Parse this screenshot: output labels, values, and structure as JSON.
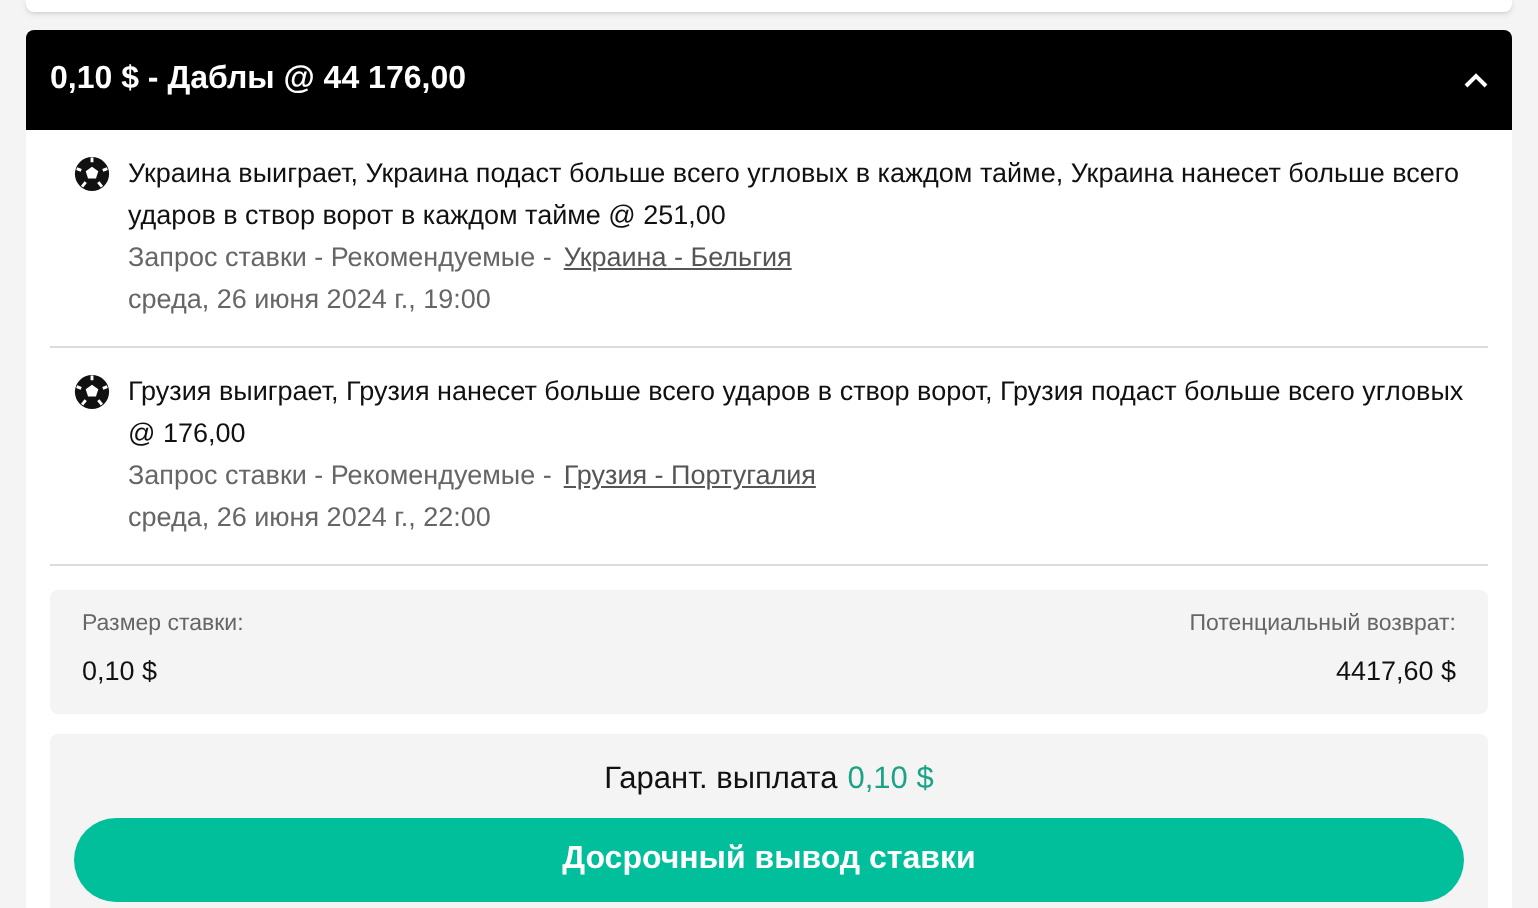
{
  "header": {
    "title": "0,10 $ - Даблы @ 44 176,00",
    "expanded": true
  },
  "selections": [
    {
      "description": "Украина выиграет, Украина подаст больше всего угловых в каждом тайме, Украина нанесет больше всего ударов в створ ворот в каждом тайме @ 251,00",
      "market": "Запрос ставки - Рекомендуемые -",
      "event": "Украина - Бельгия",
      "date": "среда, 26 июня 2024 г., 19:00"
    },
    {
      "description": "Грузия выиграет, Грузия нанесет больше всего ударов в створ ворот, Грузия подаст больше всего угловых @ 176,00",
      "market": "Запрос ставки - Рекомендуемые -",
      "event": "Грузия - Португалия",
      "date": "среда, 26 июня 2024 г., 22:00"
    }
  ],
  "stake": {
    "label": "Размер ставки:",
    "value": "0,10 $"
  },
  "potential_return": {
    "label": "Потенциальный возврат:",
    "value": "4417,60 $"
  },
  "guaranteed_payout": {
    "label": "Гарант. выплата",
    "value": "0,10 $"
  },
  "cashout_button": "Досрочный вывод ставки"
}
